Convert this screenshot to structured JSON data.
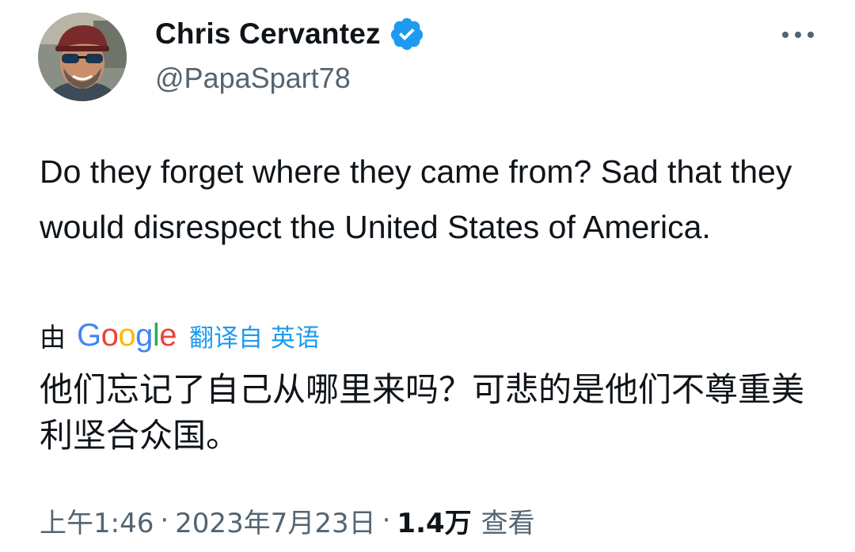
{
  "author": {
    "display_name": "Chris Cervantez",
    "handle": "@PapaSpart78",
    "verified": true,
    "avatar_icon": "avatar-photo"
  },
  "tweet": {
    "text": "Do they forget where they came from? Sad that they would disrespect the United States of America."
  },
  "translation": {
    "by_label": "由",
    "provider": "Google",
    "link_label": "翻译自 英语",
    "text": "他们忘记了自己从哪里来吗？可悲的是他们不尊重美利坚合众国。"
  },
  "meta": {
    "time": "上午1:46",
    "date": "2023年7月23日",
    "separator": "·",
    "views_count": "1.4万",
    "views_label": "查看"
  },
  "colors": {
    "link_blue": "#1d9bf0",
    "secondary_gray": "#536471",
    "text_primary": "#0f1419",
    "google_blue": "#4285F4",
    "google_red": "#EA4335",
    "google_yellow": "#FBBC05",
    "google_green": "#34A853"
  }
}
